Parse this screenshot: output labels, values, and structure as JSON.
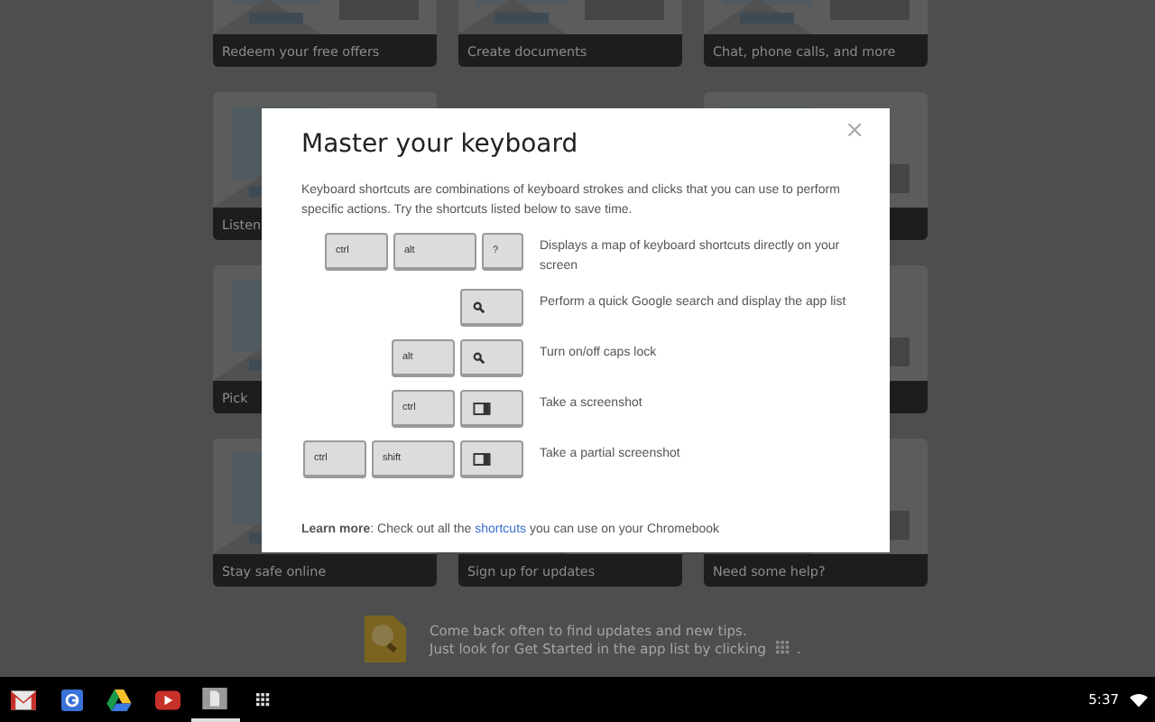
{
  "card_rows": [
    {
      "left": {
        "kind": "picture",
        "label": "Redeem your free offers"
      },
      "middle": {
        "kind": "picture",
        "label": "Create documents"
      },
      "right": {
        "kind": "picture",
        "label": "Chat, phone calls, and more"
      }
    },
    {
      "left": {
        "kind": "picture",
        "label": "Listen"
      }
    },
    {
      "left": {
        "kind": "picture",
        "label": "Pick"
      }
    },
    {
      "left": {
        "kind": "picture",
        "label": "Stay safe online"
      },
      "middle": {
        "kind": "picture",
        "label": "Sign up for updates"
      },
      "right": {
        "kind": "picture",
        "label": "Need some help?"
      }
    }
  ],
  "tip": {
    "line_1": "Come back often to find updates and new tips.",
    "line_2": "Just look for Get Started in the app list by clicking",
    "line_2_end": "."
  },
  "dialog": {
    "title": "Master your keyboard",
    "close": "×",
    "intro": "Keyboard shortcuts are combinations of keyboard strokes and clicks that you can use to perform specific actions. Try the shortcuts listed below to save time.",
    "shortcuts": [
      {
        "keys": [
          {
            "kind": "text",
            "label": "ctrl"
          },
          {
            "kind": "text",
            "label": "alt"
          },
          {
            "kind": "text",
            "label": "?"
          }
        ],
        "description": "Displays a map of keyboard shortcuts directly on your screen"
      },
      {
        "keys": [
          {
            "kind": "search"
          }
        ],
        "description": "Perform a quick Google search and display the app list"
      },
      {
        "keys": [
          {
            "kind": "text",
            "label": "alt"
          },
          {
            "kind": "search"
          }
        ],
        "description": "Turn on/off caps lock"
      },
      {
        "keys": [
          {
            "kind": "text",
            "label": "ctrl"
          },
          {
            "kind": "screenshot"
          }
        ],
        "description": "Take a screenshot"
      },
      {
        "keys": [
          {
            "kind": "text",
            "label": "ctrl"
          },
          {
            "kind": "text",
            "label": "shift"
          },
          {
            "kind": "screenshot"
          }
        ],
        "description": "Take a partial screenshot"
      }
    ],
    "learn_more": {
      "lead": "**Learn more**: Check out all the ",
      "link": "shortcuts",
      "tail": " you can use on your Chromebook"
    }
  },
  "shelf": {
    "apps": [
      {
        "kind": "gmail",
        "selected": false
      },
      {
        "kind": "google",
        "selected": false
      },
      {
        "kind": "drive",
        "selected": false
      },
      {
        "kind": "youtube",
        "selected": false
      },
      {
        "kind": "files",
        "selected": true
      },
      {
        "kind": "launcher",
        "selected": false
      }
    ],
    "time": "5:37"
  }
}
